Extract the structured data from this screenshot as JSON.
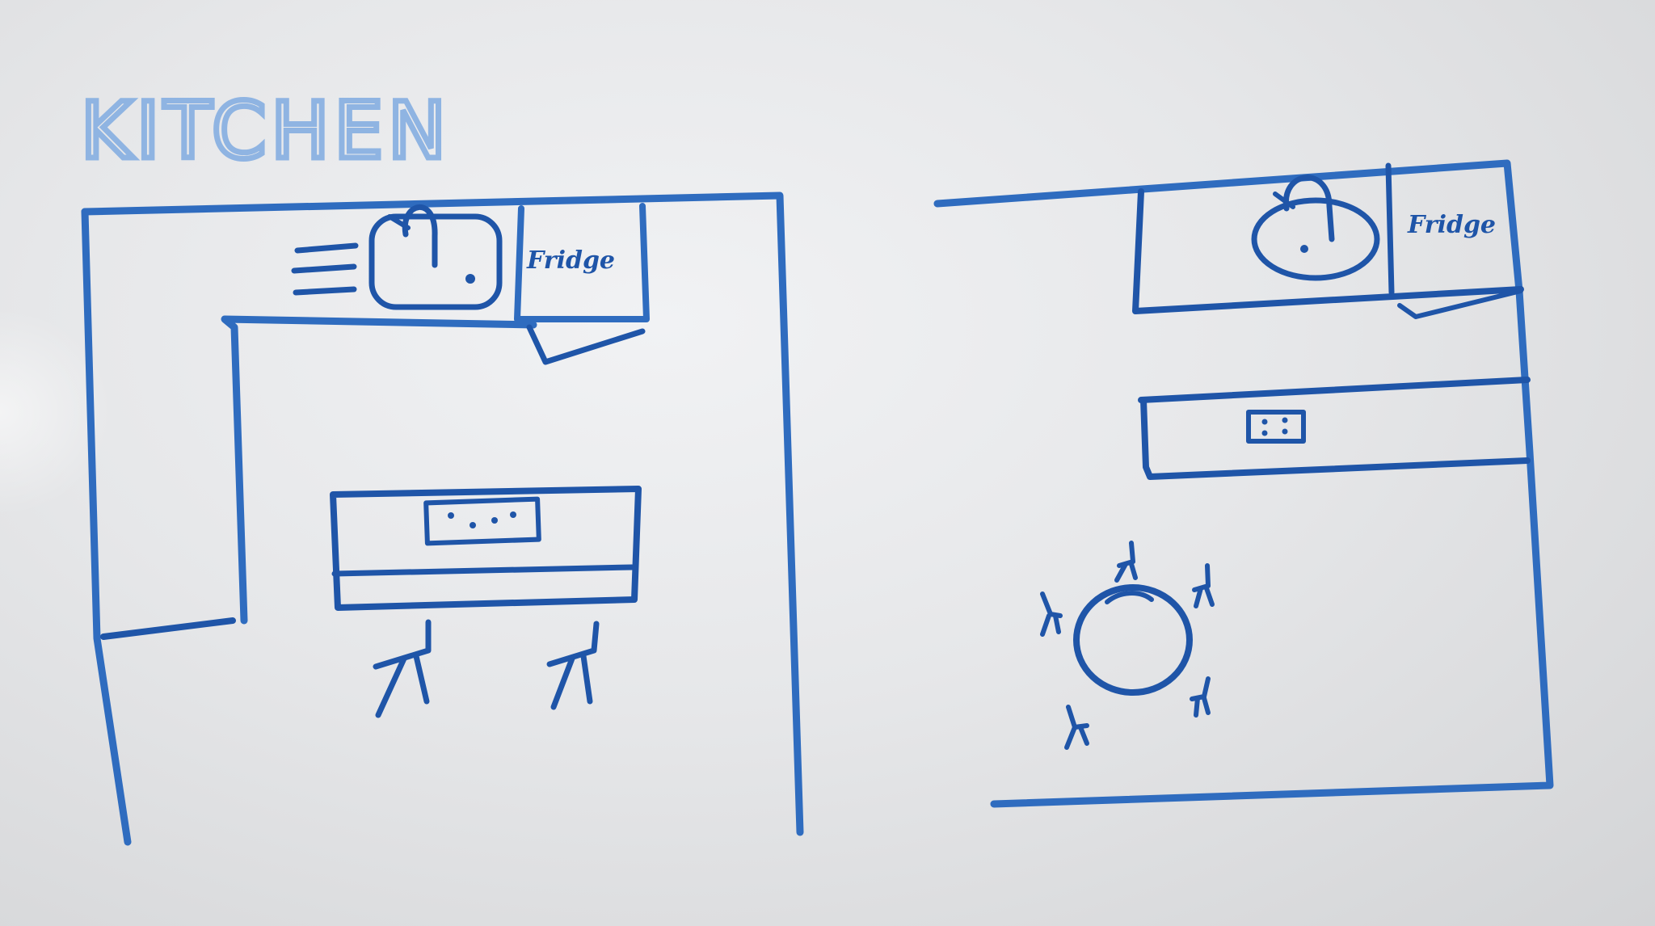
{
  "board": {
    "title": "KITCHEN",
    "ink_color": "#2f6cbf",
    "background": "#e9eaec"
  },
  "layouts": [
    {
      "fridge_label": "Fridge"
    },
    {
      "fridge_label": "Fridge"
    }
  ]
}
